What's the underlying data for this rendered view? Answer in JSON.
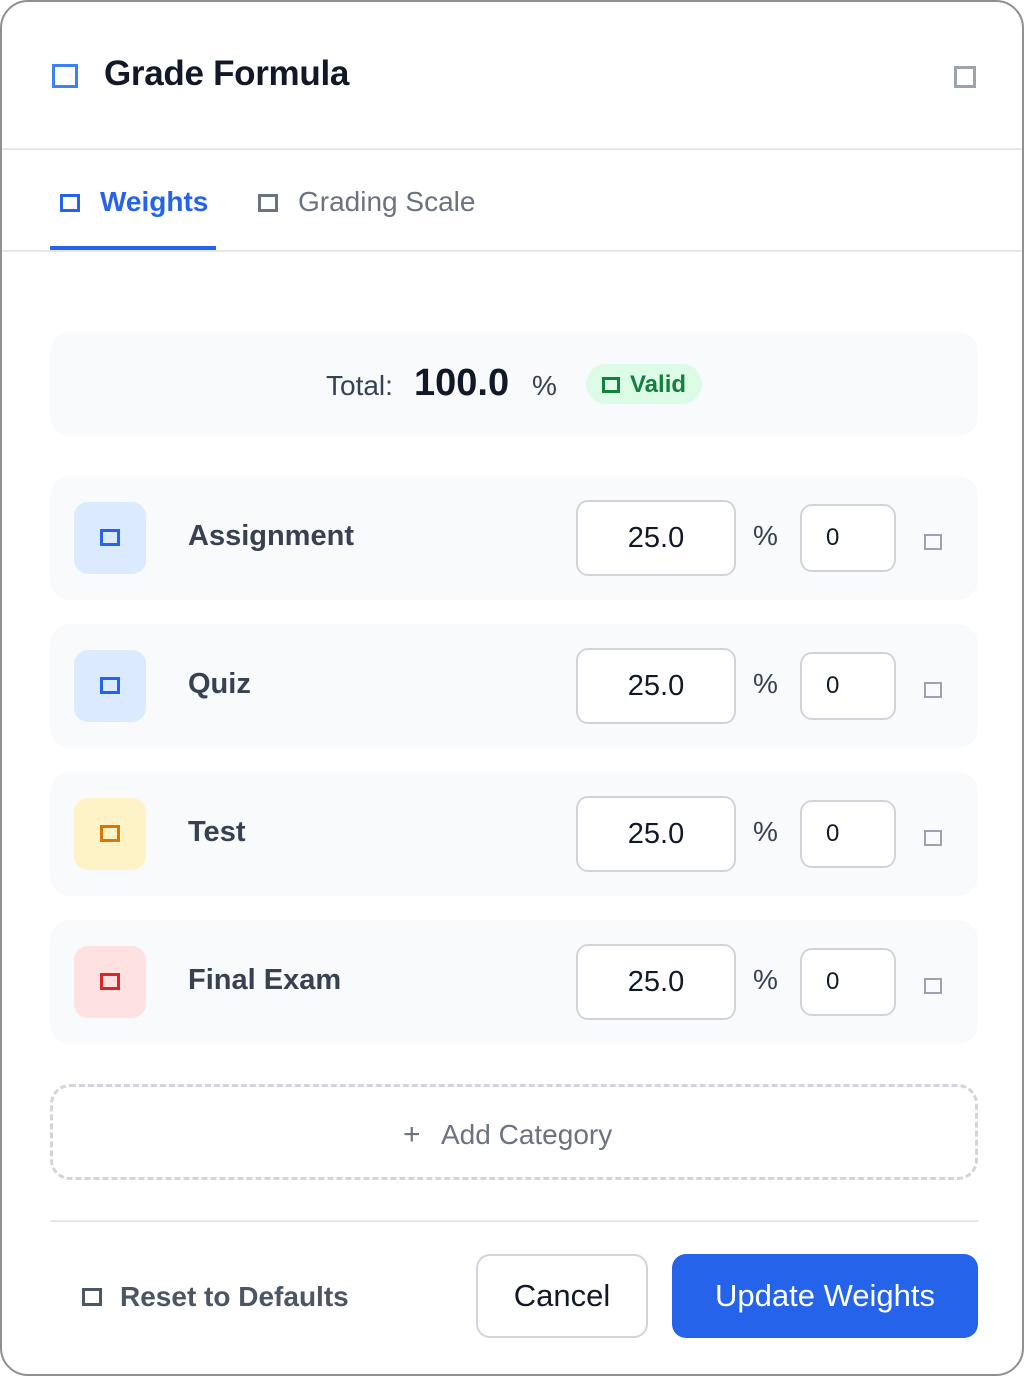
{
  "dialog": {
    "title": "Grade Formula",
    "accent_color": "#2563eb"
  },
  "tabs": [
    {
      "label": "Weights",
      "active": true
    },
    {
      "label": "Grading Scale",
      "active": false
    }
  ],
  "total": {
    "label": "Total:",
    "value": "100.0",
    "unit": "%",
    "status": "Valid",
    "status_color": "#15803d"
  },
  "categories": [
    {
      "name": "Assignment",
      "weight": "25.0",
      "unit": "%",
      "drop": "0",
      "swatch_bg": "#dbeafe",
      "icon_color": "#2563eb"
    },
    {
      "name": "Quiz",
      "weight": "25.0",
      "unit": "%",
      "drop": "0",
      "swatch_bg": "#dbeafe",
      "icon_color": "#2563eb"
    },
    {
      "name": "Test",
      "weight": "25.0",
      "unit": "%",
      "drop": "0",
      "swatch_bg": "#fef3c7",
      "icon_color": "#d97706"
    },
    {
      "name": "Final Exam",
      "weight": "25.0",
      "unit": "%",
      "drop": "0",
      "swatch_bg": "#fee2e2",
      "icon_color": "#dc2626"
    }
  ],
  "add_category": {
    "plus": "+",
    "label": "Add Category"
  },
  "footer": {
    "reset_label": "Reset to Defaults",
    "cancel_label": "Cancel",
    "submit_label": "Update Weights"
  }
}
